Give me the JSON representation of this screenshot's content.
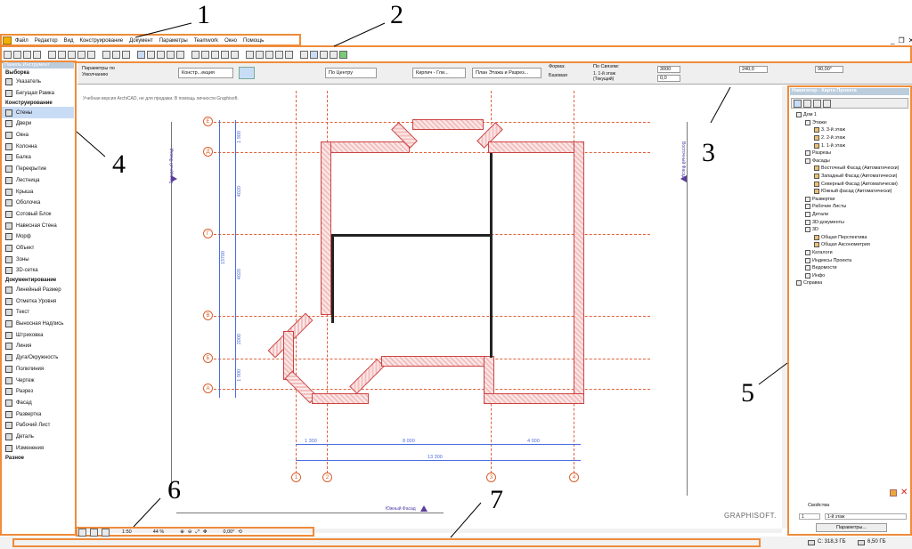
{
  "menubar": {
    "items": [
      "Файл",
      "Редактор",
      "Вид",
      "Конструирование",
      "Документ",
      "Параметры",
      "Teamwork",
      "Окно",
      "Помощь"
    ]
  },
  "infobar": {
    "defaults_label": "Параметры по Умолчанию",
    "mode_label": "Констр...екция",
    "position_label": "По Центру",
    "material_label": "Кирпич - Гли...",
    "floor_plan_label": "План Этажа и Разрез...",
    "shape_label": "Форма:",
    "shape_value": "Базовая",
    "link_label": "По Связям:",
    "link_value": "1. 1-й этаж (Текущий)",
    "height_value": "3000",
    "offset_value": "0,0",
    "width_value": "240,0",
    "angle_value": "90,00°"
  },
  "palette": {
    "title": "Панель Инструмент",
    "sections": [
      {
        "label": "Выборка",
        "items": [
          "Указатель",
          "Бегущая Рамка"
        ]
      },
      {
        "label": "Конструирование",
        "items": [
          "Стены",
          "Двери",
          "Окна",
          "Колонна",
          "Балка",
          "Перекрытие",
          "Лестница",
          "Крыша",
          "Оболочка",
          "Сотовый Блок",
          "Навесная Стена",
          "Морф",
          "Объект",
          "Зоны",
          "3D-сетка"
        ]
      },
      {
        "label": "Документирование",
        "items": [
          "Линейный Размер",
          "Отметка Уровня",
          "Текст",
          "Выносная Надпись",
          "Штриховка",
          "Линия",
          "Дуга/Окружность",
          "Полилиния",
          "Чертеж",
          "Разрез",
          "Фасад",
          "Развертка",
          "Рабочий Лист",
          "Деталь",
          "Изменения"
        ]
      },
      {
        "label": "Разное",
        "items": []
      }
    ],
    "selected": "Стены"
  },
  "canvas": {
    "watermark_note": "Учебная версия ArchiCAD, не для продажи. В помощь личности Graphisoft.",
    "west_facade": "Западный Фасад",
    "east_facade": "Восточный Фасад",
    "south_facade": "Южный Фасад",
    "brand": "GRAPHISOFT.",
    "row_axes": [
      "Е",
      "Д",
      "Г",
      "В",
      "Б",
      "А"
    ],
    "col_axes": [
      "1",
      "2",
      "3",
      "4"
    ],
    "vertical_dims": [
      "1 900",
      "4020",
      "4020",
      "2000",
      "1 900"
    ],
    "overall_vertical_dim": "13700",
    "horizontal_dims": [
      "1 300",
      "8 000",
      "4 000"
    ],
    "overall_horizontal_dim": "13 300"
  },
  "navigator": {
    "title": "Навигатор - Карта Проекта",
    "tree": [
      {
        "label": "Дом 1",
        "level": 0
      },
      {
        "label": "Этажи",
        "level": 1
      },
      {
        "label": "3. 3-й этаж",
        "level": 2
      },
      {
        "label": "2. 2-й этаж",
        "level": 2
      },
      {
        "label": "1. 1-й этаж",
        "level": 2
      },
      {
        "label": "Разрезы",
        "level": 1
      },
      {
        "label": "Фасады",
        "level": 1
      },
      {
        "label": "Восточный Фасад (Автоматически)",
        "level": 2
      },
      {
        "label": "Западный Фасад (Автоматически)",
        "level": 2
      },
      {
        "label": "Северный Фасад (Автоматически)",
        "level": 2
      },
      {
        "label": "Южный фасад (Автоматически)",
        "level": 2
      },
      {
        "label": "Развертки",
        "level": 1
      },
      {
        "label": "Рабочие Листы",
        "level": 1
      },
      {
        "label": "Детали",
        "level": 1
      },
      {
        "label": "3D-документы",
        "level": 1
      },
      {
        "label": "3D",
        "level": 1
      },
      {
        "label": "Общая Перспектива",
        "level": 2
      },
      {
        "label": "Общая Аксонометрия",
        "level": 2
      },
      {
        "label": "Каталоги",
        "level": 1
      },
      {
        "label": "Индексы Проекта",
        "level": 1
      },
      {
        "label": "Ведомости",
        "level": 1
      },
      {
        "label": "Инфо",
        "level": 1
      },
      {
        "label": "Справка",
        "level": 0
      }
    ],
    "properties_label": "Свойства",
    "id_value": "1",
    "floor_value": "1-й этаж",
    "params_button": "Параметры..."
  },
  "statusbar": {
    "scale": "1:50",
    "zoom": "44 %",
    "angle": "0,00°",
    "disk_c": "C: 318,3 ГБ",
    "memory": "6,50 ГБ"
  },
  "callouts": [
    "1",
    "2",
    "3",
    "4",
    "5",
    "6",
    "7"
  ],
  "colors": {
    "accent_orange": "#ef8b3a",
    "wall": "#c44",
    "axis": "#d8602c",
    "dim": "#4d6ee0",
    "selected": "#c9dcf5"
  }
}
